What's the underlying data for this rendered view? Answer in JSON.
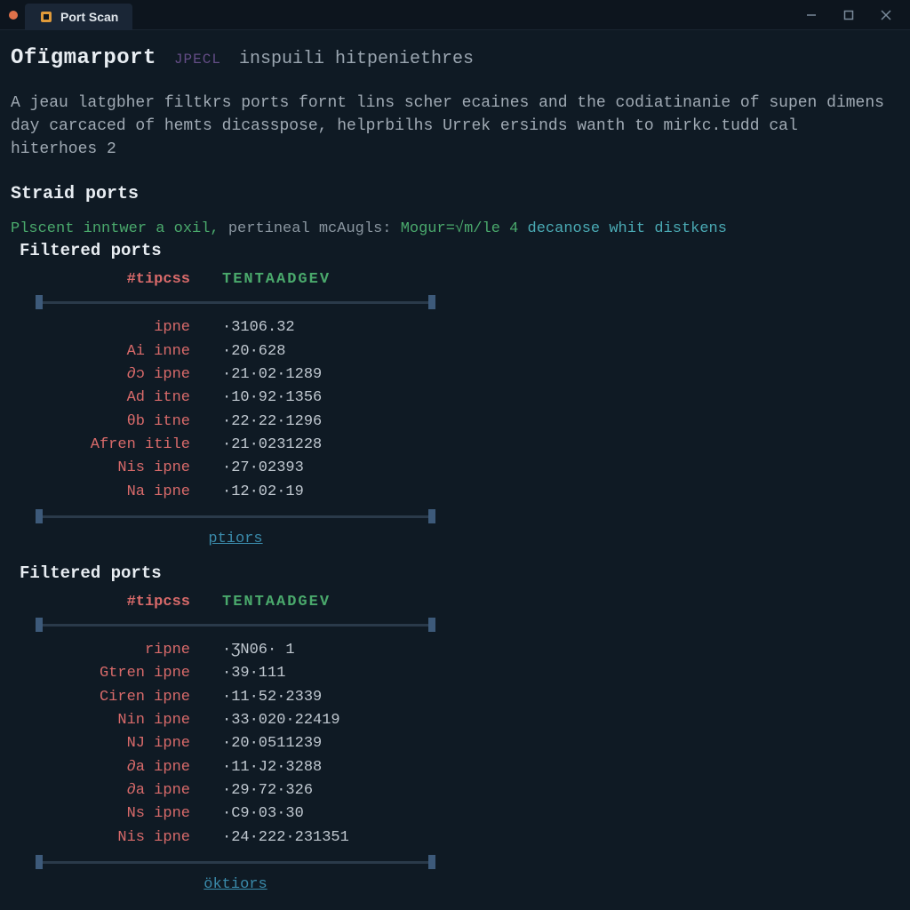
{
  "window": {
    "tab_label": "Port Scan"
  },
  "header": {
    "title": "Ofïgmarport",
    "accent": "JPECL",
    "subtitle": "inspuili  hitpeniethres"
  },
  "description": "A jeau latgbher filtkrs ports fornt lins scher ecaines and the codiatinanie of supen dimens day carcaced of hemts dicasspose, helprbilhs Urrek ersinds wanth to mirkc.tudd cal hiterhoes 2",
  "section_title": "Straid ports",
  "status_line": {
    "p1": "Plscent inntwer a oxil,",
    "p2": " pertineal mcAugls:",
    "p3": "Mogur=√m/le 4",
    "p4": " decanose whit distkens"
  },
  "tables": [
    {
      "title": "Filtered ports",
      "head": {
        "c1": "#tipcss",
        "c2": "TENTAADGEV"
      },
      "rows": [
        {
          "name": "ipne",
          "val": "·3106.32"
        },
        {
          "name": "Ai inne",
          "val": "·20·628"
        },
        {
          "name": "∂ɔ ipne",
          "val": "·21·02·1289"
        },
        {
          "name": "Ad itne",
          "val": "·10·92·1356"
        },
        {
          "name": "θb itne",
          "val": "·22·22·1296"
        },
        {
          "name": "Afren itile",
          "val": "·21·0231228"
        },
        {
          "name": "Nis ipne",
          "val": "·27·02393"
        },
        {
          "name": "Na ipne",
          "val": "·12·02·19"
        }
      ],
      "action": "ptiors"
    },
    {
      "title": "Filtered ports",
      "head": {
        "c1": "#tipcss",
        "c2": "TENTAADGEV"
      },
      "rows": [
        {
          "name": "ripne",
          "val": "·ƷN06· 1"
        },
        {
          "name": "Gtren ipne",
          "val": "·39·111"
        },
        {
          "name": "Ciren ipne",
          "val": "·11·52·2339"
        },
        {
          "name": "Nin ipne",
          "val": "·33·020·22419"
        },
        {
          "name": "NJ ipne",
          "val": "·20·0511239"
        },
        {
          "name": "∂a ipne",
          "val": "·11·J2·3288"
        },
        {
          "name": "∂a ipne",
          "val": "·29·72·326"
        },
        {
          "name": "Ns ipne",
          "val": "·С9·03·30"
        },
        {
          "name": "Nis ipne",
          "val": "·24·222·231351"
        }
      ],
      "action": "öktiors"
    }
  ]
}
